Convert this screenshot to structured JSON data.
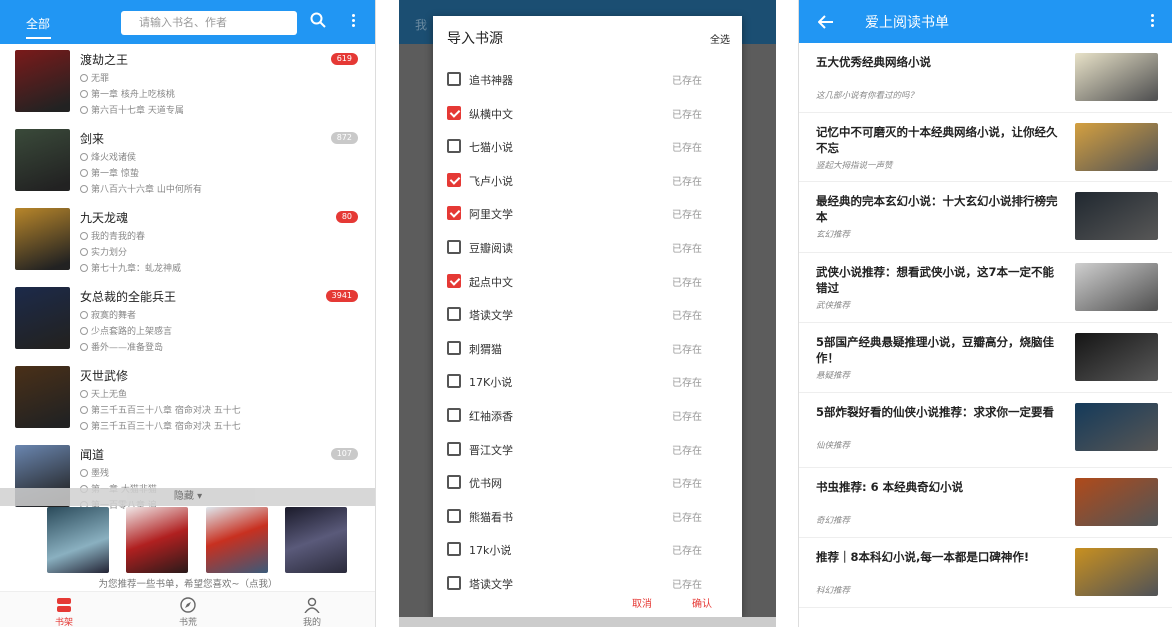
{
  "phone1": {
    "tab": "全部",
    "search_placeholder": "请输入书名、作者",
    "books": [
      {
        "title": "渡劫之王",
        "author": "无罪",
        "current": "第一章 核舟上吃核桃",
        "latest": "第六百十七章 天道专属",
        "badge": "619",
        "badge_color": "#e53935",
        "cover": "#7a1a1a"
      },
      {
        "title": "剑来",
        "author": "烽火戏诸侯",
        "current": "第一章 惊蛰",
        "latest": "第八百六十六章 山中何所有",
        "badge": "872",
        "badge_color": "#c9c9c9",
        "cover": "#3a4a3a"
      },
      {
        "title": "九天龙魂",
        "author": "我的青我的春",
        "current": "实力划分",
        "latest": "第七十九章：虬龙神威",
        "badge": "80",
        "badge_color": "#e53935",
        "cover": "#b8862a"
      },
      {
        "title": "女总裁的全能兵王",
        "author": "寂寞的舞者",
        "current": "少点套路的上架感言",
        "latest": "番外——准备登岛",
        "badge": "3941",
        "badge_color": "#e53935",
        "cover": "#1c2a4a"
      },
      {
        "title": "灭世武修",
        "author": "天上无鱼",
        "current": "第三千五百三十八章 宿命对决 五十七",
        "latest": "第三千五百三十八章 宿命对决 五十七",
        "badge": "",
        "badge_color": "#fff",
        "cover": "#4a3018"
      },
      {
        "title": "闻道",
        "author": "墨残",
        "current": "第一章 大猫非猫",
        "latest": "第一百零八章 追",
        "badge": "107",
        "badge_color": "#c9c9c9",
        "cover": "#6a86b0"
      }
    ],
    "category_bar": "隐藏 ▾",
    "recommend_text": "为您推荐一些书单，希望您喜欢~（点我）",
    "nav": [
      "书架",
      "书荒",
      "我的"
    ]
  },
  "phone2": {
    "dialog_title": "导入书源",
    "select_all": "全选",
    "status": "已存在",
    "sources": [
      {
        "name": "追书神器",
        "checked": false
      },
      {
        "name": "纵横中文",
        "checked": true
      },
      {
        "name": "七猫小说",
        "checked": false
      },
      {
        "name": "飞卢小说",
        "checked": true
      },
      {
        "name": "阿里文学",
        "checked": true
      },
      {
        "name": "豆瓣阅读",
        "checked": false
      },
      {
        "name": "起点中文",
        "checked": true
      },
      {
        "name": "塔读文学",
        "checked": false
      },
      {
        "name": "刺猬猫",
        "checked": false
      },
      {
        "name": "17K小说",
        "checked": false
      },
      {
        "name": "红袖添香",
        "checked": false
      },
      {
        "name": "晋江文学",
        "checked": false
      },
      {
        "name": "优书网",
        "checked": false
      },
      {
        "name": "熊猫看书",
        "checked": false
      },
      {
        "name": "17k小说",
        "checked": false
      },
      {
        "name": "塔读文学",
        "checked": false
      }
    ],
    "cancel": "取消",
    "confirm": "确认",
    "bg_title": "我"
  },
  "phone3": {
    "title": "爱上阅读书单",
    "items": [
      {
        "title": "五大优秀经典网络小说",
        "sub": "这几部小说有你看过的吗？",
        "color": "#e8e2c8"
      },
      {
        "title": "记忆中不可磨灭的十本经典网络小说，让你经久不忘",
        "sub": "竖起大拇指说一声赞",
        "color": "#d4a040"
      },
      {
        "title": "最经典的完本玄幻小说：十大玄幻小说排行榜完本",
        "sub": "玄幻推荐",
        "color": "#202830"
      },
      {
        "title": "武侠小说推荐：想看武侠小说，这7本一定不能错过",
        "sub": "武侠推荐",
        "color": "#cfcfcf"
      },
      {
        "title": "5部国产经典悬疑推理小说，豆瓣高分，烧脑佳作！",
        "sub": "悬疑推荐",
        "color": "#151515"
      },
      {
        "title": "5部炸裂好看的仙侠小说推荐：求求你一定要看",
        "sub": "仙侠推荐",
        "color": "#143a5a"
      },
      {
        "title": "书虫推荐: 6 本经典奇幻小说",
        "sub": "奇幻推荐",
        "color": "#b04a1a"
      },
      {
        "title": "推荐｜8本科幻小说,每一本都是口碑神作!",
        "sub": "科幻推荐",
        "color": "#c89020"
      }
    ]
  }
}
